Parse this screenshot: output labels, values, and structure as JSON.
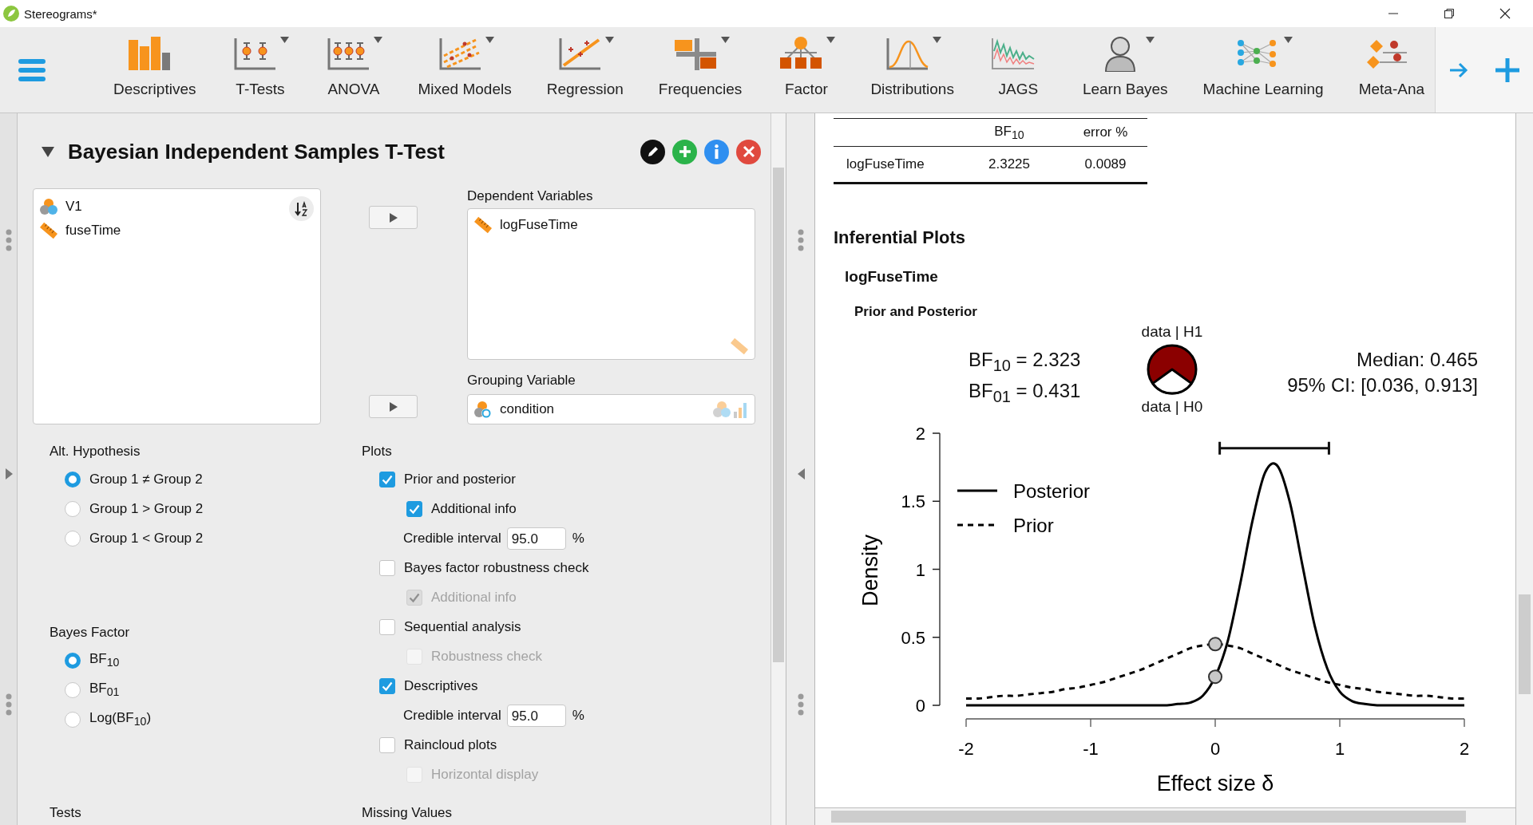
{
  "window": {
    "title": "Stereograms*"
  },
  "ribbon": {
    "items": [
      {
        "label": "Descriptives",
        "has_menu": false
      },
      {
        "label": "T-Tests",
        "has_menu": true
      },
      {
        "label": "ANOVA",
        "has_menu": true
      },
      {
        "label": "Mixed Models",
        "has_menu": true
      },
      {
        "label": "Regression",
        "has_menu": true
      },
      {
        "label": "Frequencies",
        "has_menu": true
      },
      {
        "label": "Factor",
        "has_menu": true
      },
      {
        "label": "Distributions",
        "has_menu": true
      },
      {
        "label": "JAGS",
        "has_menu": false
      },
      {
        "label": "Learn Bayes",
        "has_menu": true
      },
      {
        "label": "Machine Learning",
        "has_menu": true
      },
      {
        "label": "Meta-Ana",
        "has_menu": false
      }
    ]
  },
  "analysis": {
    "title": "Bayesian Independent Samples T-Test",
    "expanded": true,
    "available_variables": [
      {
        "name": "V1",
        "kind": "nominal"
      },
      {
        "name": "fuseTime",
        "kind": "scale"
      }
    ],
    "dependent_variables": {
      "label": "Dependent Variables",
      "items": [
        {
          "name": "logFuseTime",
          "kind": "scale"
        }
      ]
    },
    "grouping_variable": {
      "label": "Grouping Variable",
      "items": [
        {
          "name": "condition",
          "kind": "nominal_text"
        }
      ]
    },
    "alt_hypothesis": {
      "label": "Alt. Hypothesis",
      "options": [
        {
          "label": "Group 1 ≠ Group 2",
          "selected": true
        },
        {
          "label": "Group 1 > Group 2",
          "selected": false
        },
        {
          "label": "Group 1 < Group 2",
          "selected": false
        }
      ]
    },
    "bayes_factor": {
      "label": "Bayes Factor",
      "options": [
        {
          "label": "BF$_{10}$",
          "selected": true
        },
        {
          "label": "BF$_{01}$",
          "selected": false
        },
        {
          "label": "Log(BF$_{10}$)",
          "selected": false
        }
      ]
    },
    "plots": {
      "label": "Plots",
      "items": [
        {
          "kind": "checkbox",
          "label": "Prior and posterior",
          "checked": true,
          "disabled": false,
          "children": [
            {
              "kind": "checkbox",
              "label": "Additional info",
              "checked": true,
              "disabled": false
            },
            {
              "kind": "number",
              "label": "Credible interval",
              "value": "95.0",
              "unit": "%"
            }
          ]
        },
        {
          "kind": "checkbox",
          "label": "Bayes factor robustness check",
          "checked": false,
          "disabled": false,
          "children": [
            {
              "kind": "checkbox",
              "label": "Additional info",
              "checked": true,
              "disabled": true
            }
          ]
        },
        {
          "kind": "checkbox",
          "label": "Sequential analysis",
          "checked": false,
          "disabled": false,
          "children": [
            {
              "kind": "checkbox",
              "label": "Robustness check",
              "checked": false,
              "disabled": true
            }
          ]
        },
        {
          "kind": "checkbox",
          "label": "Descriptives",
          "checked": true,
          "disabled": false,
          "children": [
            {
              "kind": "number",
              "label": "Credible interval",
              "value": "95.0",
              "unit": "%"
            }
          ]
        },
        {
          "kind": "checkbox",
          "label": "Raincloud plots",
          "checked": false,
          "disabled": false,
          "children": [
            {
              "kind": "checkbox",
              "label": "Horizontal display",
              "checked": false,
              "disabled": true
            }
          ]
        }
      ]
    },
    "tests": {
      "label": "Tests"
    },
    "missing_values": {
      "label": "Missing Values"
    }
  },
  "results": {
    "table": {
      "columns": [
        "",
        "BF$_{10}$",
        "error %"
      ],
      "rows": [
        {
          "cells": [
            "logFuseTime",
            "2.3225",
            "0.0089"
          ]
        }
      ]
    },
    "heading": "Inferential Plots",
    "variable": "logFuseTime",
    "plot_title": "Prior and Posterior",
    "plot": {
      "bf10": "BF$_{10}$ = 2.323",
      "bf01": "BF$_{01}$ = 0.431",
      "wheel_top": "data | H1",
      "wheel_bottom": "data | H0",
      "median": "Median: 0.465",
      "ci": "95% CI: [0.036, 0.913]",
      "chart_data": {
        "type": "line",
        "xlabel": "Effect size δ",
        "ylabel": "Density",
        "legend": "top-left",
        "x": [
          -2,
          -1.9,
          -1.8,
          -1.7,
          -1.6,
          -1.5,
          -1.4,
          -1.3,
          -1.2,
          -1.1,
          -1,
          -0.9,
          -0.8,
          -0.7,
          -0.6,
          -0.5,
          -0.4,
          -0.3,
          -0.2,
          -0.1,
          0,
          0.1,
          0.2,
          0.3,
          0.4,
          0.5,
          0.6,
          0.7,
          0.8,
          0.9,
          1,
          1.1,
          1.2,
          1.3,
          1.4,
          1.5,
          1.6,
          1.7,
          1.8,
          1.9,
          2
        ],
        "series": [
          {
            "name": "Posterior",
            "color": "#000000",
            "line_style": "solid",
            "values": [
              0,
              0,
              0,
              0,
              0,
              0,
              0,
              0,
              0,
              0,
              0,
              0,
              0,
              0,
              0,
              0,
              0,
              0.01,
              0.02,
              0.07,
              0.21,
              0.47,
              0.89,
              1.36,
              1.71,
              1.76,
              1.49,
              1.03,
              0.58,
              0.27,
              0.1,
              0.03,
              0.01,
              0,
              0,
              0,
              0,
              0,
              0,
              0,
              0
            ]
          },
          {
            "name": "Prior",
            "color": "#000000",
            "line_style": "dashed",
            "values": [
              0.05,
              0.05,
              0.06,
              0.07,
              0.07,
              0.08,
              0.09,
              0.1,
              0.12,
              0.13,
              0.15,
              0.17,
              0.2,
              0.23,
              0.26,
              0.3,
              0.34,
              0.38,
              0.42,
              0.44,
              0.45,
              0.44,
              0.42,
              0.38,
              0.34,
              0.3,
              0.26,
              0.23,
              0.2,
              0.17,
              0.15,
              0.13,
              0.12,
              0.1,
              0.09,
              0.08,
              0.07,
              0.07,
              0.06,
              0.05,
              0.05
            ]
          },
          {
            "color": "#111111",
            "line_style": "solid",
            "x": [
              0.036,
              0.913
            ],
            "values": [
              1.89,
              1.89
            ]
          }
        ],
        "xlim": [
          -2,
          2
        ],
        "ylim": [
          0,
          2
        ],
        "xticks": [
          -2,
          -1,
          0,
          1,
          2
        ],
        "yticks": [
          0,
          0.5,
          1,
          1.5,
          2
        ]
      }
    }
  }
}
